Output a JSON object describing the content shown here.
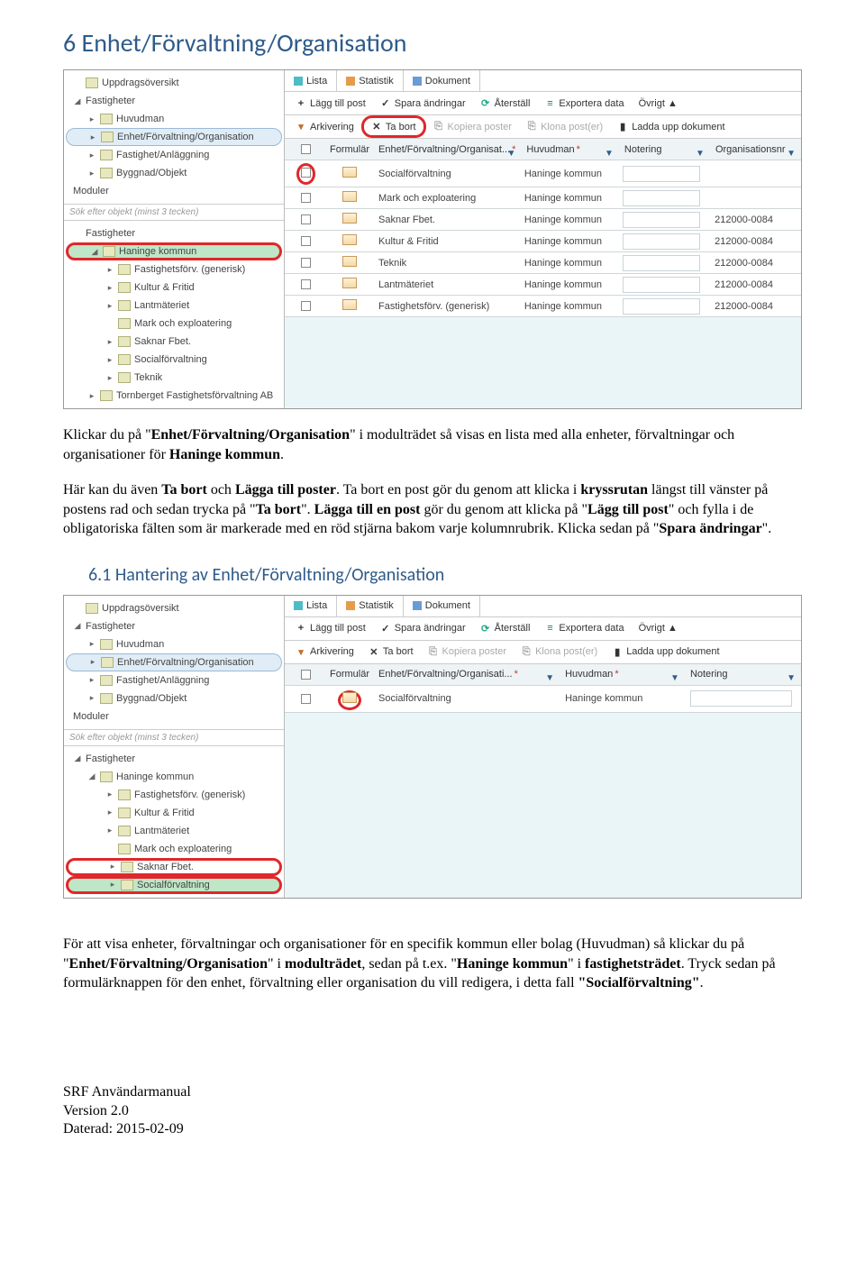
{
  "heading1": "6   Enhet/Förvaltning/Organisation",
  "heading2": "6.1   Hantering av Enhet/Förvaltning/Organisation",
  "para1_parts": [
    "Klickar du på \"",
    "Enhet/Förvaltning/Organisation",
    "\" i modulträdet så visas en lista med alla enheter, förvaltningar och organisationer för ",
    "Haninge kommun",
    "."
  ],
  "para2_parts": [
    "Här kan du även ",
    "Ta bort",
    " och ",
    "Lägga till poster",
    ". Ta bort en post gör du genom att klicka i ",
    "kryssrutan",
    " längst till vänster på postens rad och sedan trycka på \"",
    "Ta bort",
    "\". ",
    "Lägga till en post",
    " gör du genom att klicka på \"",
    "Lägg till post",
    "\" och fylla i de obligatoriska fälten som är markerade med en röd stjärna bakom varje kolumnrubrik. Klicka sedan på \"",
    "Spara ändringar",
    "\"."
  ],
  "para3_parts": [
    "För att visa enheter, förvaltningar och organisationer för en specifik kommun eller bolag (Huvudman) så klickar du på \"",
    "Enhet/Förvaltning/Organisation",
    "\" i   ",
    "modulträdet",
    ", sedan på t.ex. \"",
    "Haninge kommun",
    "\" i ",
    "fastighetsträdet",
    ". Tryck sedan på   formulärknappen för den enhet, förvaltning eller organisation du vill redigera, i detta fall ",
    "\"Socialförvaltning\"",
    "."
  ],
  "footer": {
    "l1": "SRF Användarmanual",
    "l2": "Version 2.0",
    "l3": "Daterad: 2015-02-09"
  },
  "nav": {
    "uppdrag": "Uppdragsöversikt",
    "fastigheter": "Fastigheter",
    "huvudman": "Huvudman",
    "efo": "Enhet/Förvaltning/Organisation",
    "fastan": "Fastighet/Anläggning",
    "byggnad": "Byggnad/Objekt",
    "moduler": "Moduler"
  },
  "search_placeholder": "Sök efter objekt (minst 3 tecken)",
  "tree2": {
    "fastigheter": "Fastigheter",
    "haninge": "Haninge kommun",
    "items": [
      "Fastighetsförv. (generisk)",
      "Kultur & Fritid",
      "Lantmäteriet",
      "Mark och exploatering",
      "Saknar Fbet.",
      "Socialförvaltning",
      "Teknik"
    ],
    "torn": "Tornberget Fastighetsförvaltning AB"
  },
  "tabs": {
    "lista": "Lista",
    "statistik": "Statistik",
    "dokument": "Dokument"
  },
  "toolbar": {
    "add": "Lägg till post",
    "save": "Spara ändringar",
    "reset": "Återställ",
    "export": "Exportera data",
    "other": "Övrigt ▲",
    "arch": "Arkivering",
    "del": "Ta bort",
    "copy": "Kopiera poster",
    "clone": "Klona post(er)",
    "upload": "Ladda upp dokument"
  },
  "cols": {
    "form": "Formulär",
    "enh": "Enhet/Förvaltning/Organisat...",
    "huv": "Huvudman",
    "not": "Notering",
    "org": "Organisationsnr"
  },
  "rows1": [
    {
      "enh": "Socialförvaltning",
      "huv": "Haninge kommun",
      "org": ""
    },
    {
      "enh": "Mark och exploatering",
      "huv": "Haninge kommun",
      "org": ""
    },
    {
      "enh": "Saknar Fbet.",
      "huv": "Haninge kommun",
      "org": "212000-0084"
    },
    {
      "enh": "Kultur & Fritid",
      "huv": "Haninge kommun",
      "org": "212000-0084"
    },
    {
      "enh": "Teknik",
      "huv": "Haninge kommun",
      "org": "212000-0084"
    },
    {
      "enh": "Lantmäteriet",
      "huv": "Haninge kommun",
      "org": "212000-0084"
    },
    {
      "enh": "Fastighetsförv. (generisk)",
      "huv": "Haninge kommun",
      "org": "212000-0084"
    }
  ],
  "cols2": {
    "form": "Formulär",
    "enh": "Enhet/Förvaltning/Organisati...",
    "huv": "Huvudman",
    "not": "Notering"
  },
  "rows2": [
    {
      "enh": "Socialförvaltning",
      "huv": "Haninge kommun"
    }
  ]
}
